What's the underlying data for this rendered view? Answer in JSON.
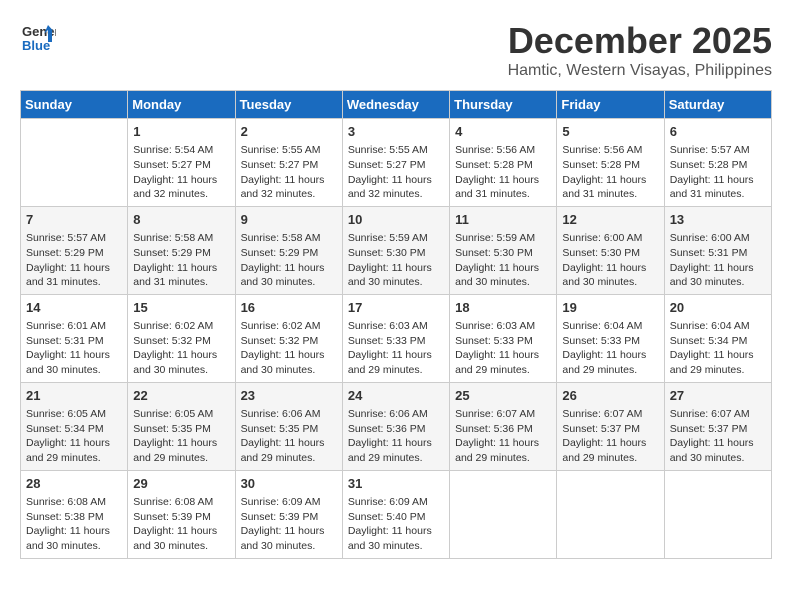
{
  "header": {
    "logo_line1": "General",
    "logo_line2": "Blue",
    "month_title": "December 2025",
    "subtitle": "Hamtic, Western Visayas, Philippines"
  },
  "weekdays": [
    "Sunday",
    "Monday",
    "Tuesday",
    "Wednesday",
    "Thursday",
    "Friday",
    "Saturday"
  ],
  "weeks": [
    [
      {
        "day": "",
        "sunrise": "",
        "sunset": "",
        "daylight": ""
      },
      {
        "day": "1",
        "sunrise": "Sunrise: 5:54 AM",
        "sunset": "Sunset: 5:27 PM",
        "daylight": "Daylight: 11 hours and 32 minutes."
      },
      {
        "day": "2",
        "sunrise": "Sunrise: 5:55 AM",
        "sunset": "Sunset: 5:27 PM",
        "daylight": "Daylight: 11 hours and 32 minutes."
      },
      {
        "day": "3",
        "sunrise": "Sunrise: 5:55 AM",
        "sunset": "Sunset: 5:27 PM",
        "daylight": "Daylight: 11 hours and 32 minutes."
      },
      {
        "day": "4",
        "sunrise": "Sunrise: 5:56 AM",
        "sunset": "Sunset: 5:28 PM",
        "daylight": "Daylight: 11 hours and 31 minutes."
      },
      {
        "day": "5",
        "sunrise": "Sunrise: 5:56 AM",
        "sunset": "Sunset: 5:28 PM",
        "daylight": "Daylight: 11 hours and 31 minutes."
      },
      {
        "day": "6",
        "sunrise": "Sunrise: 5:57 AM",
        "sunset": "Sunset: 5:28 PM",
        "daylight": "Daylight: 11 hours and 31 minutes."
      }
    ],
    [
      {
        "day": "7",
        "sunrise": "Sunrise: 5:57 AM",
        "sunset": "Sunset: 5:29 PM",
        "daylight": "Daylight: 11 hours and 31 minutes."
      },
      {
        "day": "8",
        "sunrise": "Sunrise: 5:58 AM",
        "sunset": "Sunset: 5:29 PM",
        "daylight": "Daylight: 11 hours and 31 minutes."
      },
      {
        "day": "9",
        "sunrise": "Sunrise: 5:58 AM",
        "sunset": "Sunset: 5:29 PM",
        "daylight": "Daylight: 11 hours and 30 minutes."
      },
      {
        "day": "10",
        "sunrise": "Sunrise: 5:59 AM",
        "sunset": "Sunset: 5:30 PM",
        "daylight": "Daylight: 11 hours and 30 minutes."
      },
      {
        "day": "11",
        "sunrise": "Sunrise: 5:59 AM",
        "sunset": "Sunset: 5:30 PM",
        "daylight": "Daylight: 11 hours and 30 minutes."
      },
      {
        "day": "12",
        "sunrise": "Sunrise: 6:00 AM",
        "sunset": "Sunset: 5:30 PM",
        "daylight": "Daylight: 11 hours and 30 minutes."
      },
      {
        "day": "13",
        "sunrise": "Sunrise: 6:00 AM",
        "sunset": "Sunset: 5:31 PM",
        "daylight": "Daylight: 11 hours and 30 minutes."
      }
    ],
    [
      {
        "day": "14",
        "sunrise": "Sunrise: 6:01 AM",
        "sunset": "Sunset: 5:31 PM",
        "daylight": "Daylight: 11 hours and 30 minutes."
      },
      {
        "day": "15",
        "sunrise": "Sunrise: 6:02 AM",
        "sunset": "Sunset: 5:32 PM",
        "daylight": "Daylight: 11 hours and 30 minutes."
      },
      {
        "day": "16",
        "sunrise": "Sunrise: 6:02 AM",
        "sunset": "Sunset: 5:32 PM",
        "daylight": "Daylight: 11 hours and 30 minutes."
      },
      {
        "day": "17",
        "sunrise": "Sunrise: 6:03 AM",
        "sunset": "Sunset: 5:33 PM",
        "daylight": "Daylight: 11 hours and 29 minutes."
      },
      {
        "day": "18",
        "sunrise": "Sunrise: 6:03 AM",
        "sunset": "Sunset: 5:33 PM",
        "daylight": "Daylight: 11 hours and 29 minutes."
      },
      {
        "day": "19",
        "sunrise": "Sunrise: 6:04 AM",
        "sunset": "Sunset: 5:33 PM",
        "daylight": "Daylight: 11 hours and 29 minutes."
      },
      {
        "day": "20",
        "sunrise": "Sunrise: 6:04 AM",
        "sunset": "Sunset: 5:34 PM",
        "daylight": "Daylight: 11 hours and 29 minutes."
      }
    ],
    [
      {
        "day": "21",
        "sunrise": "Sunrise: 6:05 AM",
        "sunset": "Sunset: 5:34 PM",
        "daylight": "Daylight: 11 hours and 29 minutes."
      },
      {
        "day": "22",
        "sunrise": "Sunrise: 6:05 AM",
        "sunset": "Sunset: 5:35 PM",
        "daylight": "Daylight: 11 hours and 29 minutes."
      },
      {
        "day": "23",
        "sunrise": "Sunrise: 6:06 AM",
        "sunset": "Sunset: 5:35 PM",
        "daylight": "Daylight: 11 hours and 29 minutes."
      },
      {
        "day": "24",
        "sunrise": "Sunrise: 6:06 AM",
        "sunset": "Sunset: 5:36 PM",
        "daylight": "Daylight: 11 hours and 29 minutes."
      },
      {
        "day": "25",
        "sunrise": "Sunrise: 6:07 AM",
        "sunset": "Sunset: 5:36 PM",
        "daylight": "Daylight: 11 hours and 29 minutes."
      },
      {
        "day": "26",
        "sunrise": "Sunrise: 6:07 AM",
        "sunset": "Sunset: 5:37 PM",
        "daylight": "Daylight: 11 hours and 29 minutes."
      },
      {
        "day": "27",
        "sunrise": "Sunrise: 6:07 AM",
        "sunset": "Sunset: 5:37 PM",
        "daylight": "Daylight: 11 hours and 30 minutes."
      }
    ],
    [
      {
        "day": "28",
        "sunrise": "Sunrise: 6:08 AM",
        "sunset": "Sunset: 5:38 PM",
        "daylight": "Daylight: 11 hours and 30 minutes."
      },
      {
        "day": "29",
        "sunrise": "Sunrise: 6:08 AM",
        "sunset": "Sunset: 5:39 PM",
        "daylight": "Daylight: 11 hours and 30 minutes."
      },
      {
        "day": "30",
        "sunrise": "Sunrise: 6:09 AM",
        "sunset": "Sunset: 5:39 PM",
        "daylight": "Daylight: 11 hours and 30 minutes."
      },
      {
        "day": "31",
        "sunrise": "Sunrise: 6:09 AM",
        "sunset": "Sunset: 5:40 PM",
        "daylight": "Daylight: 11 hours and 30 minutes."
      },
      {
        "day": "",
        "sunrise": "",
        "sunset": "",
        "daylight": ""
      },
      {
        "day": "",
        "sunrise": "",
        "sunset": "",
        "daylight": ""
      },
      {
        "day": "",
        "sunrise": "",
        "sunset": "",
        "daylight": ""
      }
    ]
  ]
}
